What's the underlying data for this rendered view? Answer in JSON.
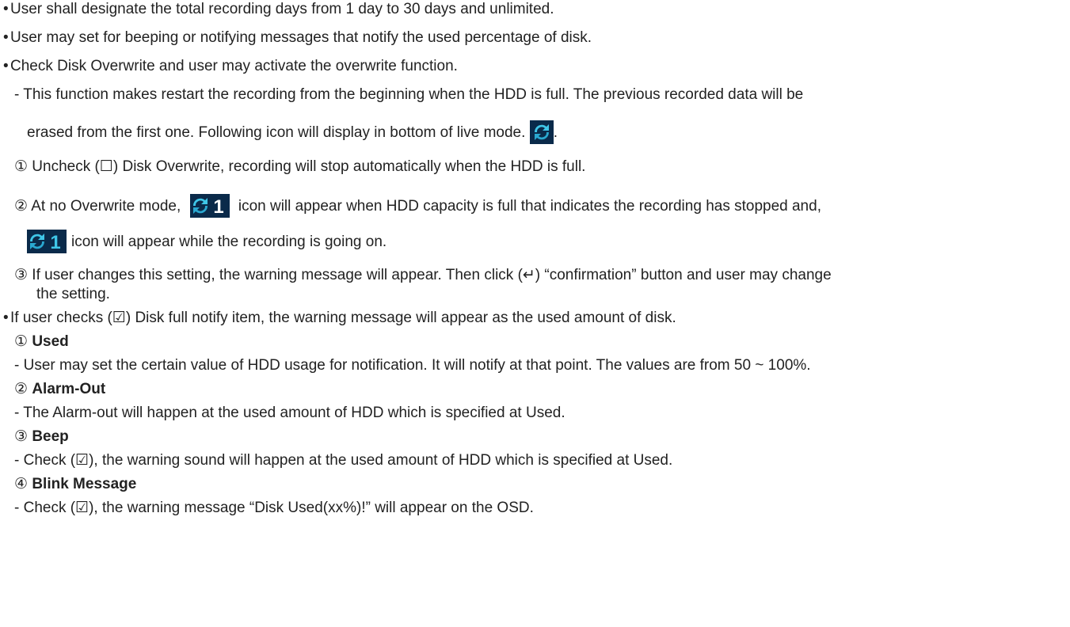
{
  "bullets": {
    "record_days": "User shall designate the total recording days from 1 day to 30 days and unlimited.",
    "beep_notify": "User may set for beeping or notifying messages that notify the used percentage of disk.",
    "overwrite": "Check Disk Overwrite and user may activate the overwrite function.",
    "disk_full": "If user checks (☑) Disk full notify item, the warning message will appear as the used amount of disk."
  },
  "overwrite_detail": {
    "line1": "- This function makes restart the recording from the beginning when the HDD is full. The previous recorded data will be",
    "line2": "erased from the first one. Following icon will display in bottom of live mode.",
    "line2_end": ".",
    "item1": "① Uncheck (☐) Disk Overwrite, recording will stop automatically when the HDD is full.",
    "item2_a": "② At no Overwrite mode,",
    "item2_b": "icon will appear when HDD capacity is full that indicates the recording has stopped and,",
    "item2_c": "icon will appear while the recording is going on.",
    "item3_a": "③ If user changes this setting, the warning message will appear. Then click (↵) “confirmation” button and user may change",
    "item3_b": "the setting."
  },
  "notify_items": [
    {
      "num": "①",
      "title": "Used",
      "desc": "- User may set the certain value of HDD usage for notification. It will notify at that point. The values are from 50 ~ 100%."
    },
    {
      "num": "②",
      "title": "Alarm-Out",
      "desc": "- The Alarm-out will happen at the used amount of HDD which is specified at Used."
    },
    {
      "num": "③",
      "title": "Beep",
      "desc": "- Check (☑), the warning sound will happen at the used amount of HDD which is specified at Used."
    },
    {
      "num": "④",
      "title": "Blink Message",
      "desc": "- Check (☑), the warning message “Disk Used(xx%)!” will appear on the OSD."
    }
  ],
  "icons": {
    "overwrite": "overwrite-icon",
    "stopped": "record-stopped-icon",
    "recording": "recording-icon"
  },
  "colors": {
    "icon_bg": "#0a2a4a",
    "icon_accent": "#3fc6e8",
    "icon_digit": "#ffffff"
  }
}
